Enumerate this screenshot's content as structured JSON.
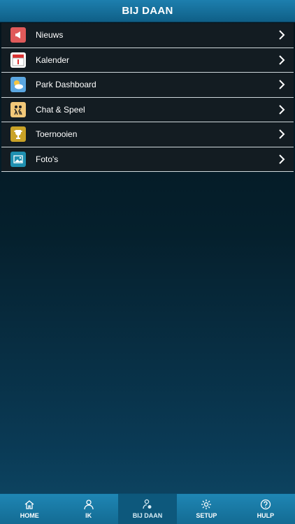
{
  "header": {
    "title": "BIJ DAAN"
  },
  "menu": {
    "items": [
      {
        "label": "Nieuws",
        "icon": "megaphone-icon",
        "color": "#e05a5a"
      },
      {
        "label": "Kalender",
        "icon": "calendar-icon",
        "color": "#ffffff"
      },
      {
        "label": "Park Dashboard",
        "icon": "weather-icon",
        "color": "#5aa6e0"
      },
      {
        "label": "Chat & Speel",
        "icon": "chat-play-icon",
        "color": "#f2c879"
      },
      {
        "label": "Toernooien",
        "icon": "trophy-icon",
        "color": "#c9a227"
      },
      {
        "label": "Foto's",
        "icon": "photo-icon",
        "color": "#1f8fb0"
      }
    ]
  },
  "tabbar": {
    "tabs": [
      {
        "label": "HOME",
        "icon": "home-icon",
        "active": false
      },
      {
        "label": "IK",
        "icon": "person-icon",
        "active": false
      },
      {
        "label": "BIJ DAAN",
        "icon": "person-pin-icon",
        "active": true
      },
      {
        "label": "SETUP",
        "icon": "gear-icon",
        "active": false
      },
      {
        "label": "HULP",
        "icon": "help-icon",
        "active": false
      }
    ]
  }
}
